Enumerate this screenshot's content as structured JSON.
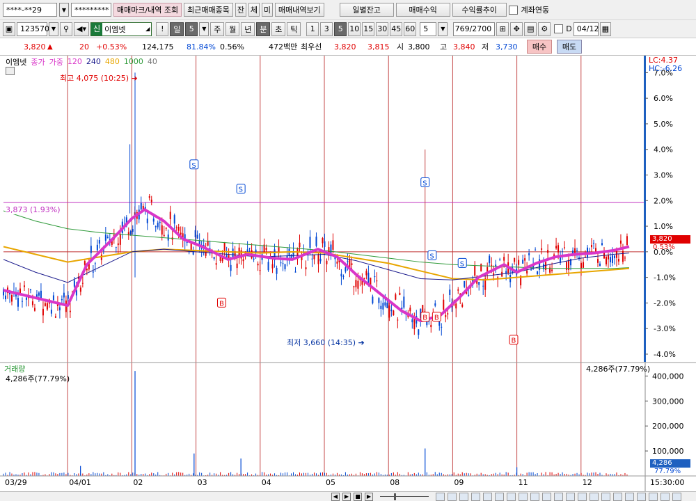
{
  "toolbar1": {
    "account": "****-**29",
    "password": "*********",
    "buttons": [
      "매매마크/내역 조회",
      "최근매매종목",
      "잔",
      "체",
      "미",
      "매매내역보기"
    ],
    "right_buttons": [
      "일별잔고",
      "매매수익",
      "수익률추이"
    ],
    "link_label": "계좌연동"
  },
  "toolbar2": {
    "code": "123570",
    "credit_badge": "신",
    "stock_name": "이엠넷",
    "period_buttons": [
      "일",
      "5",
      "주",
      "월",
      "년",
      "분",
      "초",
      "틱"
    ],
    "minute_options": [
      "1",
      "3",
      "5",
      "10",
      "15",
      "30",
      "45",
      "60"
    ],
    "selected_minute": "5",
    "interval_value": "5",
    "count_display": "769",
    "count_total": "/2700",
    "date_value": "04/12",
    "checkbox_label": "D"
  },
  "quote": {
    "price": "3,820",
    "arrow": "▲",
    "change": "20",
    "change_pct": "+0.53%",
    "volume": "124,175",
    "vol_ratio": "81.84%",
    "turnover": "0.56%",
    "amount": "472백만",
    "best_label": "최우선",
    "best_ask": "3,820",
    "best_bid": "3,815",
    "open_label": "시",
    "open": "3,800",
    "high_label": "고",
    "high": "3,840",
    "low_label": "저",
    "low": "3,730",
    "buy_label": "매수",
    "sell_label": "매도"
  },
  "colors": {
    "up": "#e00000",
    "down": "#0047d4",
    "ma5": "#d936c8",
    "ma120": "#1a1a8c",
    "ma240": "#e8a600",
    "ma480": "#2f9a3a",
    "vline": "#c44848",
    "hline": "#c030c0"
  },
  "chart_data": {
    "type": "candlestick",
    "legend": {
      "name": "이엠넷",
      "items": [
        "종가",
        "가중",
        "120",
        "240",
        "480",
        "1000",
        "40"
      ]
    },
    "right_labels": {
      "lc": "LC:4.37",
      "hc": "HC:-6.26"
    },
    "y_ticks": [
      "7.0%",
      "6.0%",
      "5.0%",
      "4.0%",
      "3.0%",
      "2.0%",
      "1.0%",
      "0.0%",
      "-1.0%",
      "-2.0%",
      "-3.0%",
      "-4.0%"
    ],
    "y_tick_values": [
      7,
      6,
      5,
      4,
      3,
      2,
      1,
      0,
      -1,
      -2,
      -3,
      -4
    ],
    "ylim": [
      -4.3,
      7.5
    ],
    "last_price_tag": "3,820",
    "last_pct_tag": "0.53%",
    "hline_label": "3,873 (1.93%)",
    "hline_value": 1.93,
    "annotations": {
      "high": "최고 4,075 (10:25)",
      "low": "최저 3,660 (14:35)"
    },
    "x_ticks": [
      "03/29",
      "04/01",
      "02",
      "03",
      "04",
      "05",
      "08",
      "09",
      "11",
      "12"
    ],
    "x_tick_time": "15:30:00",
    "x_tick_pos": [
      0,
      0.1,
      0.2,
      0.3,
      0.4,
      0.5,
      0.6,
      0.7,
      0.8,
      0.9
    ],
    "trade_marks": [
      {
        "type": "S",
        "x": 0.297,
        "y": 3.4
      },
      {
        "type": "S",
        "x": 0.37,
        "y": 2.45
      },
      {
        "type": "B",
        "x": 0.34,
        "y": -2.0
      },
      {
        "type": "S",
        "x": 0.657,
        "y": 2.7
      },
      {
        "type": "S",
        "x": 0.668,
        "y": -0.15
      },
      {
        "type": "S",
        "x": 0.715,
        "y": -0.45
      },
      {
        "type": "B",
        "x": 0.657,
        "y": -2.55
      },
      {
        "type": "B",
        "x": 0.675,
        "y": -2.55
      },
      {
        "type": "B",
        "x": 0.795,
        "y": -3.45
      }
    ],
    "ma5_path": [
      [
        0,
        -1.5
      ],
      [
        0.05,
        -1.8
      ],
      [
        0.1,
        -2.1
      ],
      [
        0.13,
        -0.5
      ],
      [
        0.17,
        0.5
      ],
      [
        0.2,
        1.3
      ],
      [
        0.22,
        1.65
      ],
      [
        0.25,
        1.2
      ],
      [
        0.28,
        0.5
      ],
      [
        0.31,
        0.2
      ],
      [
        0.35,
        -0.3
      ],
      [
        0.38,
        -0.1
      ],
      [
        0.42,
        -0.25
      ],
      [
        0.45,
        -0.3
      ],
      [
        0.49,
        0.1
      ],
      [
        0.52,
        -0.2
      ],
      [
        0.55,
        -0.9
      ],
      [
        0.59,
        -1.7
      ],
      [
        0.62,
        -2.3
      ],
      [
        0.65,
        -2.7
      ],
      [
        0.68,
        -2.5
      ],
      [
        0.71,
        -1.8
      ],
      [
        0.74,
        -1.0
      ],
      [
        0.78,
        -0.5
      ],
      [
        0.8,
        -0.8
      ],
      [
        0.83,
        -0.45
      ],
      [
        0.86,
        -0.2
      ],
      [
        0.89,
        -0.1
      ],
      [
        0.92,
        -0.05
      ],
      [
        0.95,
        0.05
      ],
      [
        0.975,
        0.2
      ]
    ],
    "ma120_path": [
      [
        0,
        -0.3
      ],
      [
        0.05,
        -0.8
      ],
      [
        0.1,
        -1.2
      ],
      [
        0.15,
        -0.6
      ],
      [
        0.2,
        0.0
      ],
      [
        0.25,
        0.1
      ],
      [
        0.3,
        0.0
      ],
      [
        0.35,
        -0.1
      ],
      [
        0.4,
        -0.2
      ],
      [
        0.45,
        -0.15
      ],
      [
        0.5,
        -0.1
      ],
      [
        0.55,
        -0.35
      ],
      [
        0.6,
        -0.7
      ],
      [
        0.65,
        -1.05
      ],
      [
        0.7,
        -1.1
      ],
      [
        0.75,
        -0.95
      ],
      [
        0.8,
        -0.8
      ],
      [
        0.85,
        -0.5
      ],
      [
        0.9,
        -0.25
      ],
      [
        0.95,
        -0.1
      ],
      [
        0.975,
        -0.05
      ]
    ],
    "ma240_path": [
      [
        0,
        0.2
      ],
      [
        0.05,
        -0.1
      ],
      [
        0.1,
        -0.4
      ],
      [
        0.15,
        -0.2
      ],
      [
        0.2,
        0.0
      ],
      [
        0.25,
        0.1
      ],
      [
        0.3,
        0.05
      ],
      [
        0.35,
        0.0
      ],
      [
        0.4,
        -0.05
      ],
      [
        0.45,
        0.0
      ],
      [
        0.5,
        -0.05
      ],
      [
        0.55,
        -0.25
      ],
      [
        0.6,
        -0.45
      ],
      [
        0.65,
        -0.75
      ],
      [
        0.7,
        -1.05
      ],
      [
        0.75,
        -1.1
      ],
      [
        0.8,
        -1.0
      ],
      [
        0.85,
        -0.9
      ],
      [
        0.9,
        -0.8
      ],
      [
        0.95,
        -0.7
      ],
      [
        0.975,
        -0.65
      ]
    ],
    "ma480_path": [
      [
        0,
        1.6
      ],
      [
        0.05,
        1.2
      ],
      [
        0.1,
        0.9
      ],
      [
        0.15,
        0.75
      ],
      [
        0.2,
        0.65
      ],
      [
        0.25,
        0.55
      ],
      [
        0.3,
        0.45
      ],
      [
        0.35,
        0.35
      ],
      [
        0.4,
        0.25
      ],
      [
        0.45,
        0.15
      ],
      [
        0.5,
        0.05
      ],
      [
        0.55,
        -0.1
      ],
      [
        0.6,
        -0.25
      ],
      [
        0.65,
        -0.4
      ],
      [
        0.7,
        -0.5
      ],
      [
        0.75,
        -0.55
      ],
      [
        0.8,
        -0.6
      ],
      [
        0.85,
        -0.65
      ],
      [
        0.9,
        -0.65
      ],
      [
        0.95,
        -0.65
      ],
      [
        0.975,
        -0.62
      ]
    ],
    "vlines_x": [
      0.1,
      0.2,
      0.3,
      0.4,
      0.5,
      0.6,
      0.7,
      0.8,
      0.9
    ],
    "volume": {
      "title": "거래량",
      "current": "4,286주(77.79%)",
      "y_ticks": [
        "400,000",
        "300,000",
        "200,000",
        "100,000"
      ],
      "y_tick_values": [
        400000,
        300000,
        200000,
        100000
      ],
      "ymax": 440000,
      "last_tag": "4,286",
      "last_pct": "77.79%",
      "spikes": [
        [
          0.205,
          420000
        ],
        [
          0.297,
          90000
        ],
        [
          0.37,
          70000
        ],
        [
          0.657,
          110000
        ],
        [
          0.12,
          40000
        ],
        [
          0.8,
          35000
        ]
      ]
    }
  },
  "statusbar": {
    "nav_buttons": [
      "◀",
      "▶",
      "■",
      "▶"
    ]
  }
}
